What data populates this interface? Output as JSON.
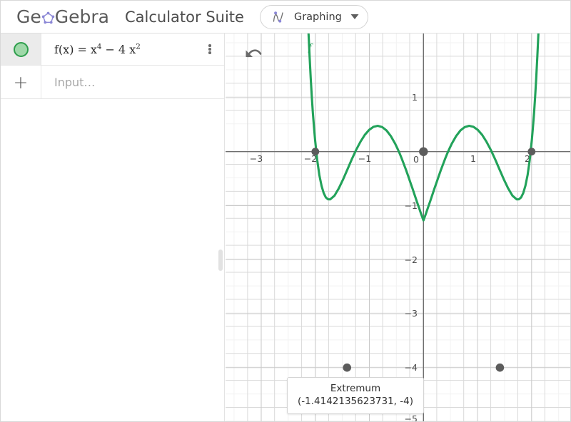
{
  "header": {
    "logo_text_left": "Ge",
    "logo_text_right": "Gebra",
    "logo_mark_name": "geogebra-pentagon-logo",
    "app_title": "Calculator Suite",
    "mode_label": "Graphing",
    "mode_icon": "graphing-curve-icon",
    "caret_icon": "chevron-down-icon",
    "accent_purple": "#8b87d6"
  },
  "sidebar": {
    "rows": [
      {
        "marble_name": "visibility-toggle-marble",
        "marble_fill": "#9fd8a9",
        "marble_stroke": "#2e9e4c",
        "formula_plain": "f(x) = x^4 - 4 x^2",
        "lhs": "f(x)",
        "eq": "=",
        "term1_base": "x",
        "term1_exp": "4",
        "minus": "−",
        "coef": "4",
        "term2_base": "x",
        "term2_exp": "2",
        "menu_icon": "kebab-menu-icon"
      }
    ],
    "input_row": {
      "plus_icon": "plus-icon",
      "placeholder": "Input…",
      "value": ""
    }
  },
  "graph": {
    "undo_icon": "undo-arrow-icon",
    "curve_label": "f",
    "curve_color": "#22a25a",
    "point_color": "#5c5c5c",
    "tooltip": {
      "title": "Extremum",
      "coords": "(-1.4142135623731, -4)"
    }
  },
  "chart_data": {
    "type": "line",
    "title": "",
    "xlabel": "",
    "ylabel": "",
    "function": "f(x) = x^4 - 4x^2",
    "xlim": [
      -3.9,
      2.7
    ],
    "ylim": [
      -5.2,
      1.8
    ],
    "grid": true,
    "grid_step": 0.5,
    "xticks": [
      -3,
      -2,
      -1,
      0,
      1,
      2
    ],
    "xtick_labels": [
      "−3",
      "−2",
      "−1",
      "0",
      "1",
      "2"
    ],
    "yticks": [
      1,
      0,
      -1,
      -2,
      -3,
      -4,
      -5
    ],
    "ytick_labels": [
      "1",
      "0",
      "−1",
      "−2",
      "−3",
      "−4",
      "−5"
    ],
    "series": [
      {
        "name": "f",
        "color": "#22a25a",
        "expression": "x^4 - 4*x^2"
      }
    ],
    "points": [
      {
        "name": "root-left",
        "x": -2,
        "y": 0
      },
      {
        "name": "root-origin",
        "x": 0,
        "y": 0
      },
      {
        "name": "root-right",
        "x": 2,
        "y": 0
      },
      {
        "name": "minimum-left",
        "x": -1.4142135623731,
        "y": -4
      },
      {
        "name": "minimum-right",
        "x": 1.4142135623731,
        "y": -4
      }
    ],
    "annotations": [
      {
        "text": "Extremum",
        "x": -1.4142135623731,
        "y": -4
      },
      {
        "text": "(-1.4142135623731, -4)",
        "x": -1.4142135623731,
        "y": -4
      }
    ]
  }
}
